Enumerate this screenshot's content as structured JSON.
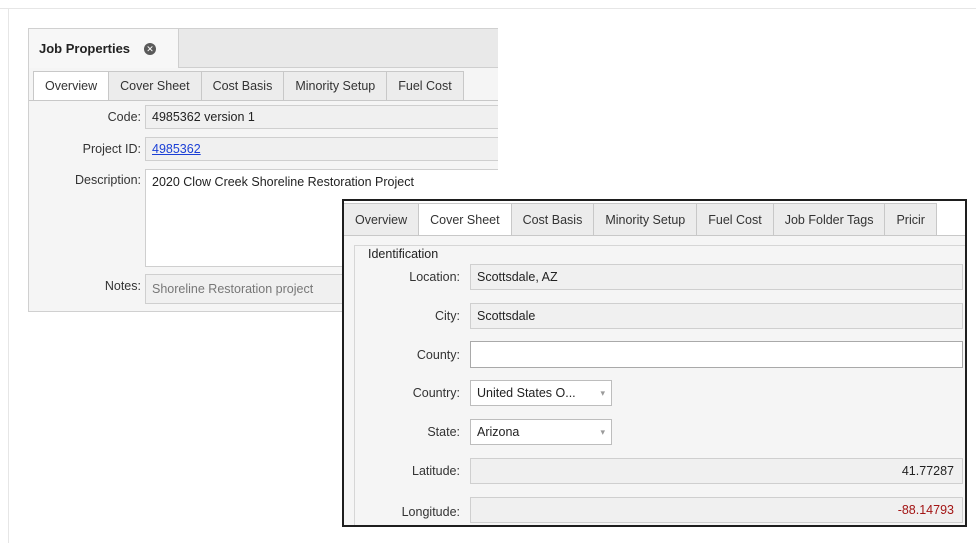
{
  "job_properties": {
    "title": "Job Properties",
    "close_glyph": "✕",
    "tabs": [
      {
        "label": "Overview"
      },
      {
        "label": "Cover Sheet"
      },
      {
        "label": "Cost Basis"
      },
      {
        "label": "Minority Setup"
      },
      {
        "label": "Fuel Cost"
      }
    ],
    "active_tab": "Overview",
    "fields": {
      "code_label": "Code:",
      "code_value": "4985362 version 1",
      "project_id_label": "Project ID:",
      "project_id_value": "4985362",
      "description_label": "Description:",
      "description_value": "2020 Clow Creek Shoreline Restoration Project",
      "notes_label": "Notes:",
      "notes_value": "Shoreline Restoration project"
    }
  },
  "cover_sheet_panel": {
    "tabs": [
      {
        "label": "Overview"
      },
      {
        "label": "Cover Sheet"
      },
      {
        "label": "Cost Basis"
      },
      {
        "label": "Minority Setup"
      },
      {
        "label": "Fuel Cost"
      },
      {
        "label": "Job Folder Tags"
      },
      {
        "label": "Pricir"
      }
    ],
    "active_tab": "Cover Sheet",
    "group_title": "Identification",
    "fields": {
      "location_label": "Location:",
      "location_value": "Scottsdale, AZ",
      "city_label": "City:",
      "city_value": "Scottsdale",
      "county_label": "County:",
      "county_value": "",
      "country_label": "Country:",
      "country_value": "United States O...",
      "state_label": "State:",
      "state_value": "Arizona",
      "latitude_label": "Latitude:",
      "latitude_value": "41.77287",
      "longitude_label": "Longitude:",
      "longitude_value": "-88.14793"
    }
  },
  "colors": {
    "link": "#1a3fd6",
    "negative_value": "#a31515",
    "panel_background": "#f5f5f5"
  },
  "icons": {
    "close": "close-icon",
    "dropdown": "chevron-down-icon"
  }
}
